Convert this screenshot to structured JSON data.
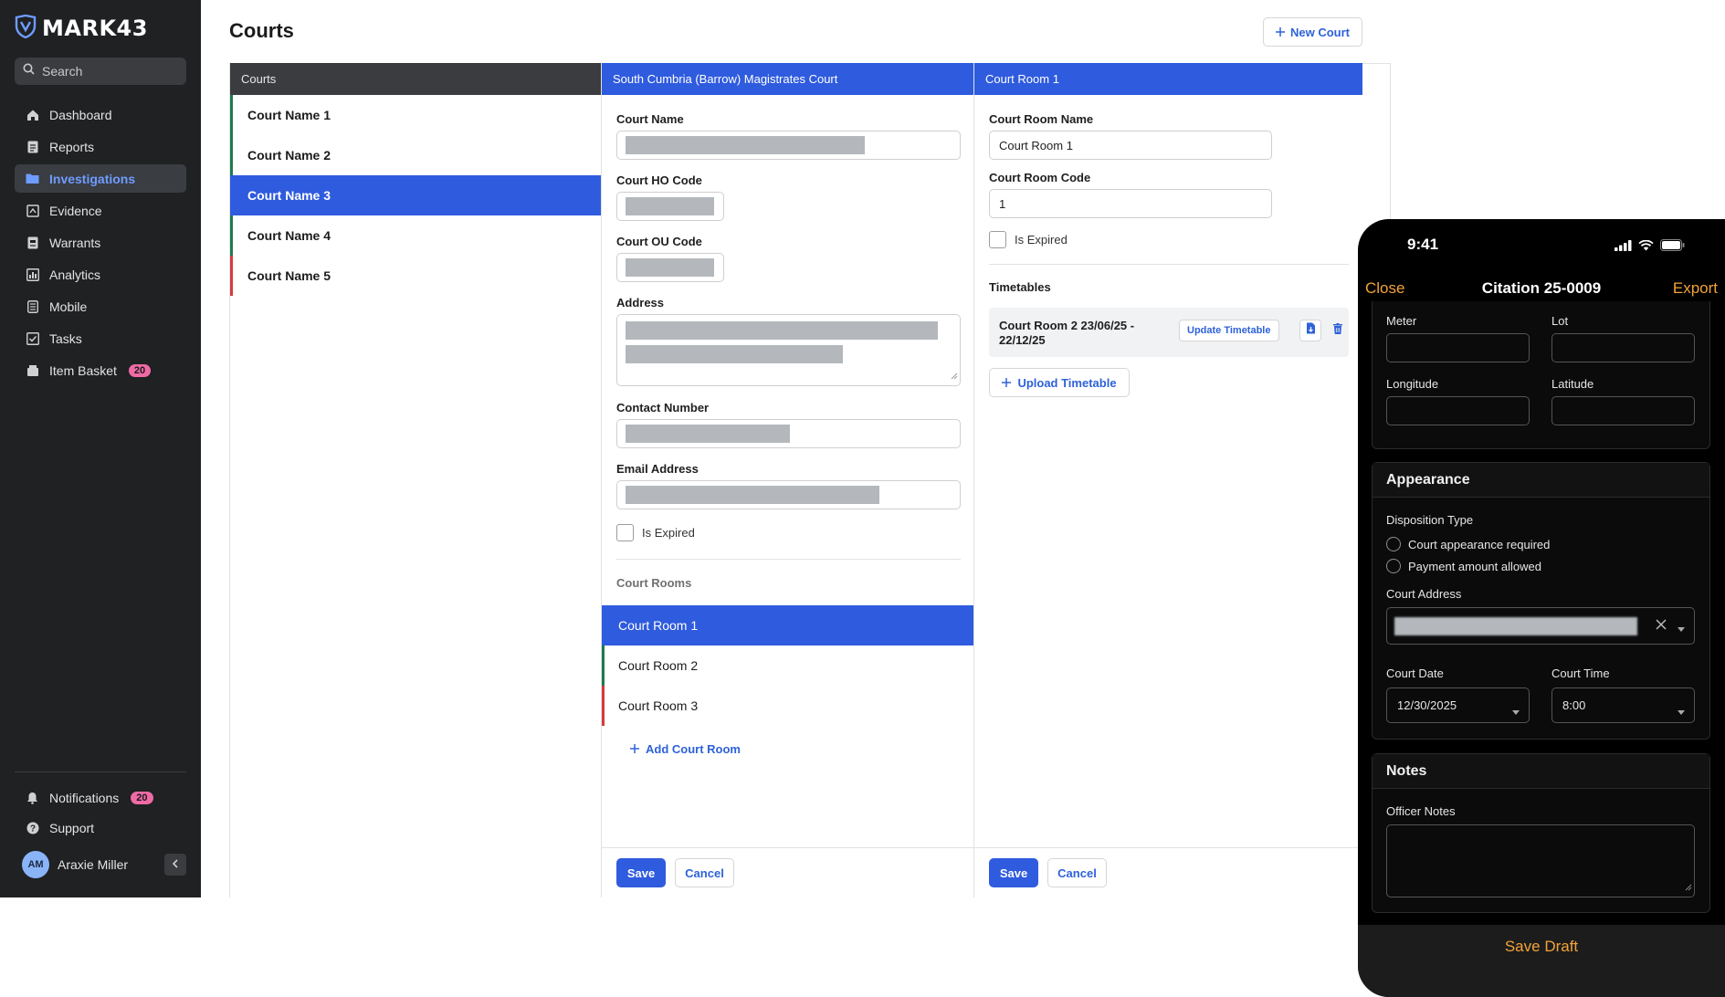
{
  "app": {
    "logo_text": "MARK43",
    "search_placeholder": "Search"
  },
  "sidebar": {
    "items": [
      {
        "label": "Dashboard",
        "icon": "home-icon"
      },
      {
        "label": "Reports",
        "icon": "document-icon"
      },
      {
        "label": "Investigations",
        "icon": "folder-icon",
        "active": true
      },
      {
        "label": "Evidence",
        "icon": "evidence-icon"
      },
      {
        "label": "Warrants",
        "icon": "warrant-icon"
      },
      {
        "label": "Analytics",
        "icon": "chart-icon"
      },
      {
        "label": "Mobile",
        "icon": "mobile-icon"
      },
      {
        "label": "Tasks",
        "icon": "checklist-icon"
      },
      {
        "label": "Item Basket",
        "icon": "basket-icon",
        "badge": "20"
      }
    ],
    "notifications_label": "Notifications",
    "notifications_badge": "20",
    "support_label": "Support",
    "user_initials": "AM",
    "user_name": "Araxie Miller"
  },
  "header": {
    "title": "Courts",
    "new_court_label": "New Court"
  },
  "courts_list": {
    "header": "Courts",
    "items": [
      "Court Name 1",
      "Court Name 2",
      "Court Name 3",
      "Court Name 4",
      "Court Name 5"
    ],
    "selected_index": 2
  },
  "court_detail": {
    "header": "South Cumbria (Barrow) Magistrates Court",
    "court_name_label": "Court Name",
    "court_ho_code_label": "Court HO Code",
    "court_ou_code_label": "Court OU Code",
    "address_label": "Address",
    "contact_number_label": "Contact Number",
    "email_label": "Email Address",
    "is_expired_label": "Is Expired",
    "court_rooms_title": "Court Rooms",
    "rooms": [
      "Court Room 1",
      "Court Room 2",
      "Court Room 3"
    ],
    "add_room_label": "Add Court Room",
    "save_label": "Save",
    "cancel_label": "Cancel"
  },
  "court_room": {
    "header": "Court Room 1",
    "name_label": "Court Room Name",
    "name_value": "Court Room 1",
    "code_label": "Court Room Code",
    "code_value": "1",
    "is_expired_label": "Is Expired",
    "timetables_title": "Timetables",
    "timetable_name": "Court Room 2 23/06/25 - 22/12/25",
    "update_timetable_label": "Update Timetable",
    "upload_timetable_label": "Upload Timetable",
    "save_label": "Save",
    "cancel_label": "Cancel"
  },
  "phone": {
    "time": "9:41",
    "close_label": "Close",
    "title": "Citation 25-0009",
    "export_label": "Export",
    "meter_label": "Meter",
    "lot_label": "Lot",
    "longitude_label": "Longitude",
    "latitude_label": "Latitude",
    "appearance_title": "Appearance",
    "disposition_label": "Disposition Type",
    "radio_1": "Court appearance required",
    "radio_2": "Payment amount allowed",
    "court_address_label": "Court Address",
    "court_date_label": "Court Date",
    "court_date_value": "12/30/2025",
    "court_time_label": "Court Time",
    "court_time_value": "8:00",
    "notes_title": "Notes",
    "officer_notes_label": "Officer Notes",
    "save_draft_label": "Save Draft"
  },
  "colors": {
    "accent": "#2f5bde",
    "sidebar_bg": "#1f2123",
    "active_nav_text": "#6f9cff",
    "status_green": "#1e7b4f",
    "status_red": "#d63a3a",
    "badge": "#f06aa6",
    "phone_accent": "#f2a33b"
  }
}
